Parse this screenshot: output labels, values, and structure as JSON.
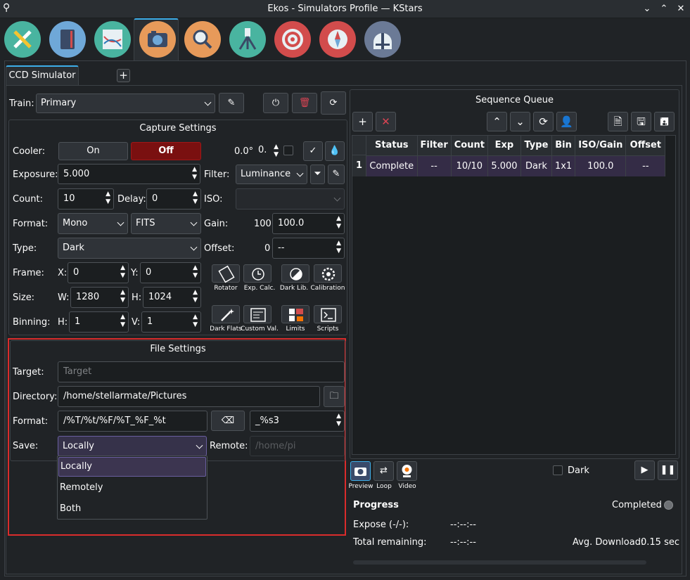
{
  "window": {
    "title": "Ekos - Simulators Profile — KStars"
  },
  "modules": [
    "setup-icon",
    "scheduler-icon",
    "analyze-icon",
    "capture-icon",
    "focus-icon",
    "mount-icon",
    "align-icon",
    "guide-icon",
    "observatory-icon"
  ],
  "tabs": {
    "active": "CCD Simulator",
    "add": "+"
  },
  "train": {
    "label": "Train:",
    "value": "Primary"
  },
  "capture": {
    "title": "Capture Settings",
    "cooler_label": "Cooler:",
    "on": "On",
    "off": "Off",
    "temp": "0.0°",
    "temp_field": "0.",
    "exposure_label": "Exposure:",
    "exposure": "5.000",
    "filter_label": "Filter:",
    "filter": "Luminance",
    "count_label": "Count:",
    "count": "10",
    "delay_label": "Delay:",
    "delay": "0",
    "iso_label": "ISO:",
    "iso": "",
    "format_label": "Format:",
    "format1": "Mono",
    "format2": "FITS",
    "gain_label": "Gain:",
    "gain_current": "100",
    "gain": "100.0",
    "type_label": "Type:",
    "type": "Dark",
    "offset_label": "Offset:",
    "offset_current": "0",
    "offset": "--",
    "frame_label": "Frame:",
    "x_label": "X:",
    "x": "0",
    "y_label": "Y:",
    "y": "0",
    "size_label": "Size:",
    "w_label": "W:",
    "w": "1280",
    "h_label": "H:",
    "h": "1024",
    "binning_label": "Binning:",
    "bh_label": "H:",
    "bh": "1",
    "bv_label": "V:",
    "bv": "1",
    "tools": [
      "Rotator",
      "Exp. Calc.",
      "Dark Lib.",
      "Calibration",
      "Dark Flats",
      "Custom Val.",
      "Limits",
      "Scripts"
    ]
  },
  "file": {
    "title": "File Settings",
    "target_label": "Target:",
    "target_placeholder": "Target",
    "directory_label": "Directory:",
    "directory": "/home/stellarmate/Pictures",
    "format_label": "Format:",
    "format": "/%T/%t/%F/%T_%F_%t",
    "suffix": "_%s3",
    "save_label": "Save:",
    "save": "Locally",
    "remote_label": "Remote:",
    "remote_placeholder": "/home/pi",
    "save_options": [
      "Locally",
      "Remotely",
      "Both"
    ]
  },
  "queue": {
    "title": "Sequence Queue",
    "columns": [
      "Status",
      "Filter",
      "Count",
      "Exp",
      "Type",
      "Bin",
      "ISO/Gain",
      "Offset"
    ],
    "rows": [
      {
        "num": "1",
        "cells": [
          "Complete",
          "--",
          "10/10",
          "5.000",
          "Dark",
          "1x1",
          "100.0",
          "--"
        ]
      }
    ]
  },
  "controls": {
    "preview": "Preview",
    "loop": "Loop",
    "video": "Video",
    "dark": "Dark"
  },
  "progress": {
    "title": "Progress",
    "status": "Completed",
    "expose_label": "Expose (-/-):",
    "expose": "--:--:--",
    "remaining_label": "Total remaining:",
    "remaining": "--:--:--",
    "download_label": "Avg. Download:",
    "download": "0.15 sec"
  }
}
